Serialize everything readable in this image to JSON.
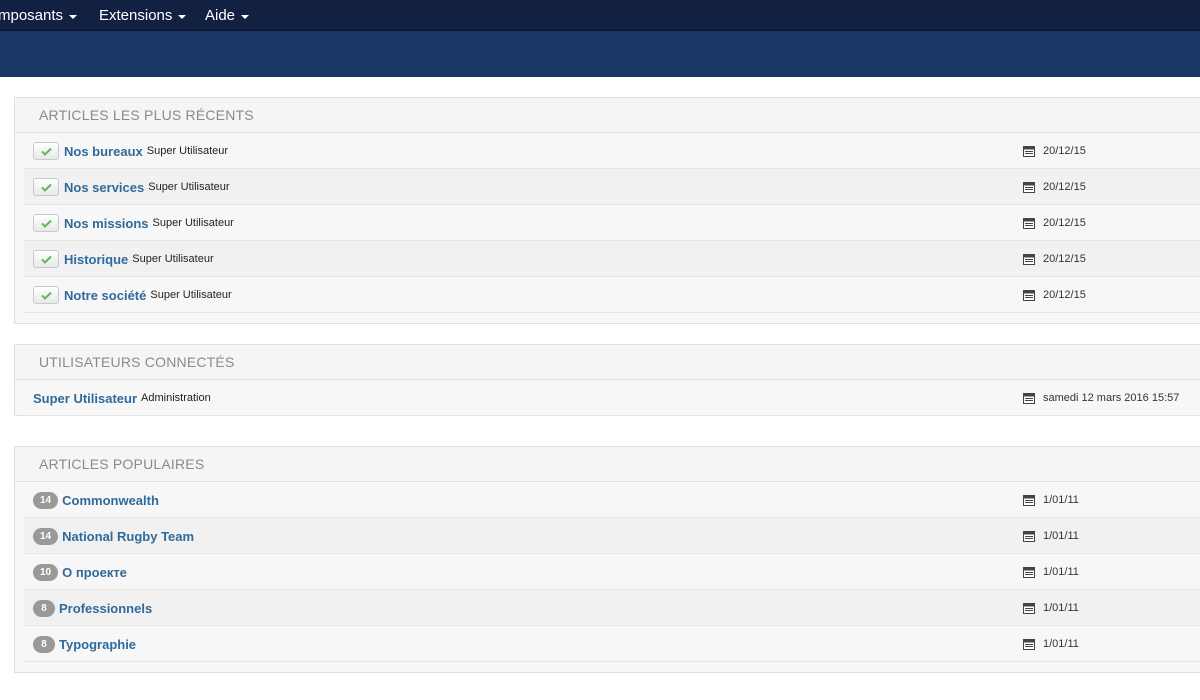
{
  "nav": {
    "items": [
      {
        "label": "mposants"
      },
      {
        "label": "Extensions"
      },
      {
        "label": "Aide"
      }
    ]
  },
  "recent": {
    "title": "ARTICLES LES PLUS RÉCENTS",
    "rows": [
      {
        "title": "Nos bureaux",
        "author": "Super Utilisateur",
        "date": "20/12/15"
      },
      {
        "title": "Nos services",
        "author": "Super Utilisateur",
        "date": "20/12/15"
      },
      {
        "title": "Nos missions",
        "author": "Super Utilisateur",
        "date": "20/12/15"
      },
      {
        "title": "Historique",
        "author": "Super Utilisateur",
        "date": "20/12/15"
      },
      {
        "title": "Notre société",
        "author": "Super Utilisateur",
        "date": "20/12/15"
      }
    ]
  },
  "users": {
    "title": "UTILISATEURS CONNECTÉS",
    "rows": [
      {
        "name": "Super Utilisateur",
        "role": "Administration",
        "date": "samedi 12 mars 2016 15:57"
      }
    ]
  },
  "popular": {
    "title": "ARTICLES POPULAIRES",
    "rows": [
      {
        "hits": "14",
        "title": "Commonwealth",
        "date": "1/01/11"
      },
      {
        "hits": "14",
        "title": "National Rugby Team",
        "date": "1/01/11"
      },
      {
        "hits": "10",
        "title": "О проекте",
        "date": "1/01/11"
      },
      {
        "hits": "8",
        "title": "Professionnels",
        "date": "1/01/11"
      },
      {
        "hits": "8",
        "title": "Typographie",
        "date": "1/01/11"
      }
    ]
  },
  "icons": {
    "published": "check-icon",
    "date": "calendar-icon",
    "caret": "caret-down-icon"
  },
  "colors": {
    "topnav": "#122142",
    "subheader": "#1a3867",
    "link": "#2f6a9c",
    "badge": "#999999",
    "check": "#5cb85c"
  }
}
